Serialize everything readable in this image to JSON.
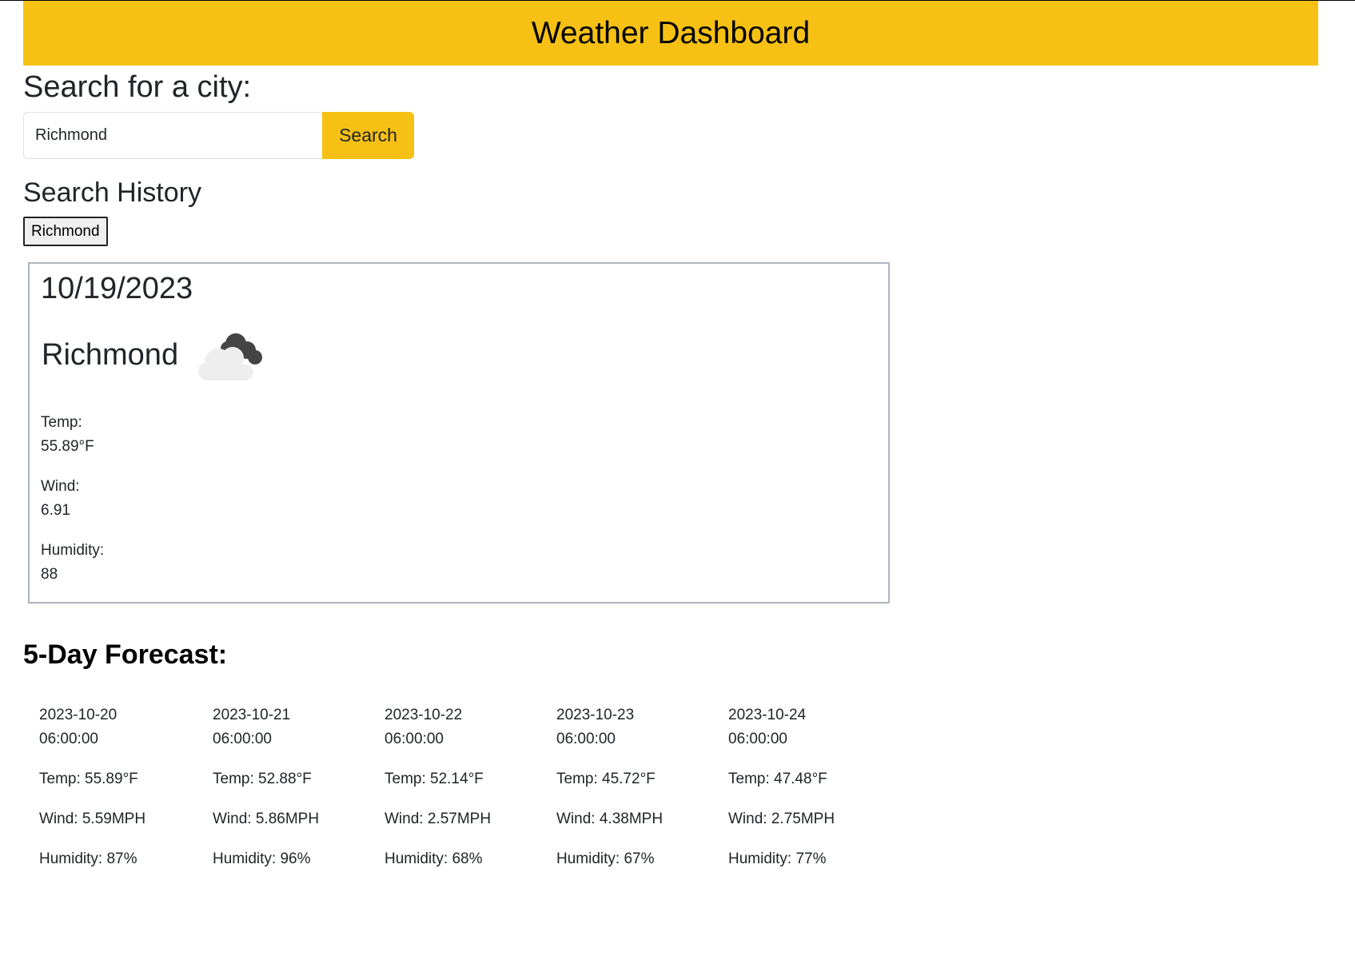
{
  "header": {
    "title": "Weather Dashboard"
  },
  "search": {
    "heading": "Search for a city:",
    "input_value": "Richmond",
    "button_label": "Search"
  },
  "history": {
    "heading": "Search History",
    "items": [
      "Richmond"
    ]
  },
  "current": {
    "date": "10/19/2023",
    "city": "Richmond",
    "icon": "cloud-icon",
    "temp_label": "Temp:",
    "temp_value": "55.89°F",
    "wind_label": "Wind:",
    "wind_value": "6.91",
    "humidity_label": "Humidity:",
    "humidity_value": "88"
  },
  "forecast": {
    "heading": "5-Day Forecast:",
    "days": [
      {
        "date": "2023-10-20",
        "time": "06:00:00",
        "temp": "Temp: 55.89°F",
        "wind": "Wind: 5.59MPH",
        "humidity": "Humidity: 87%"
      },
      {
        "date": "2023-10-21",
        "time": "06:00:00",
        "temp": "Temp: 52.88°F",
        "wind": "Wind: 5.86MPH",
        "humidity": "Humidity: 96%"
      },
      {
        "date": "2023-10-22",
        "time": "06:00:00",
        "temp": "Temp: 52.14°F",
        "wind": "Wind: 2.57MPH",
        "humidity": "Humidity: 68%"
      },
      {
        "date": "2023-10-23",
        "time": "06:00:00",
        "temp": "Temp: 45.72°F",
        "wind": "Wind: 4.38MPH",
        "humidity": "Humidity: 67%"
      },
      {
        "date": "2023-10-24",
        "time": "06:00:00",
        "temp": "Temp: 47.48°F",
        "wind": "Wind: 2.75MPH",
        "humidity": "Humidity: 77%"
      }
    ]
  },
  "colors": {
    "accent": "#f6c114",
    "card_border": "#adb5bd"
  }
}
